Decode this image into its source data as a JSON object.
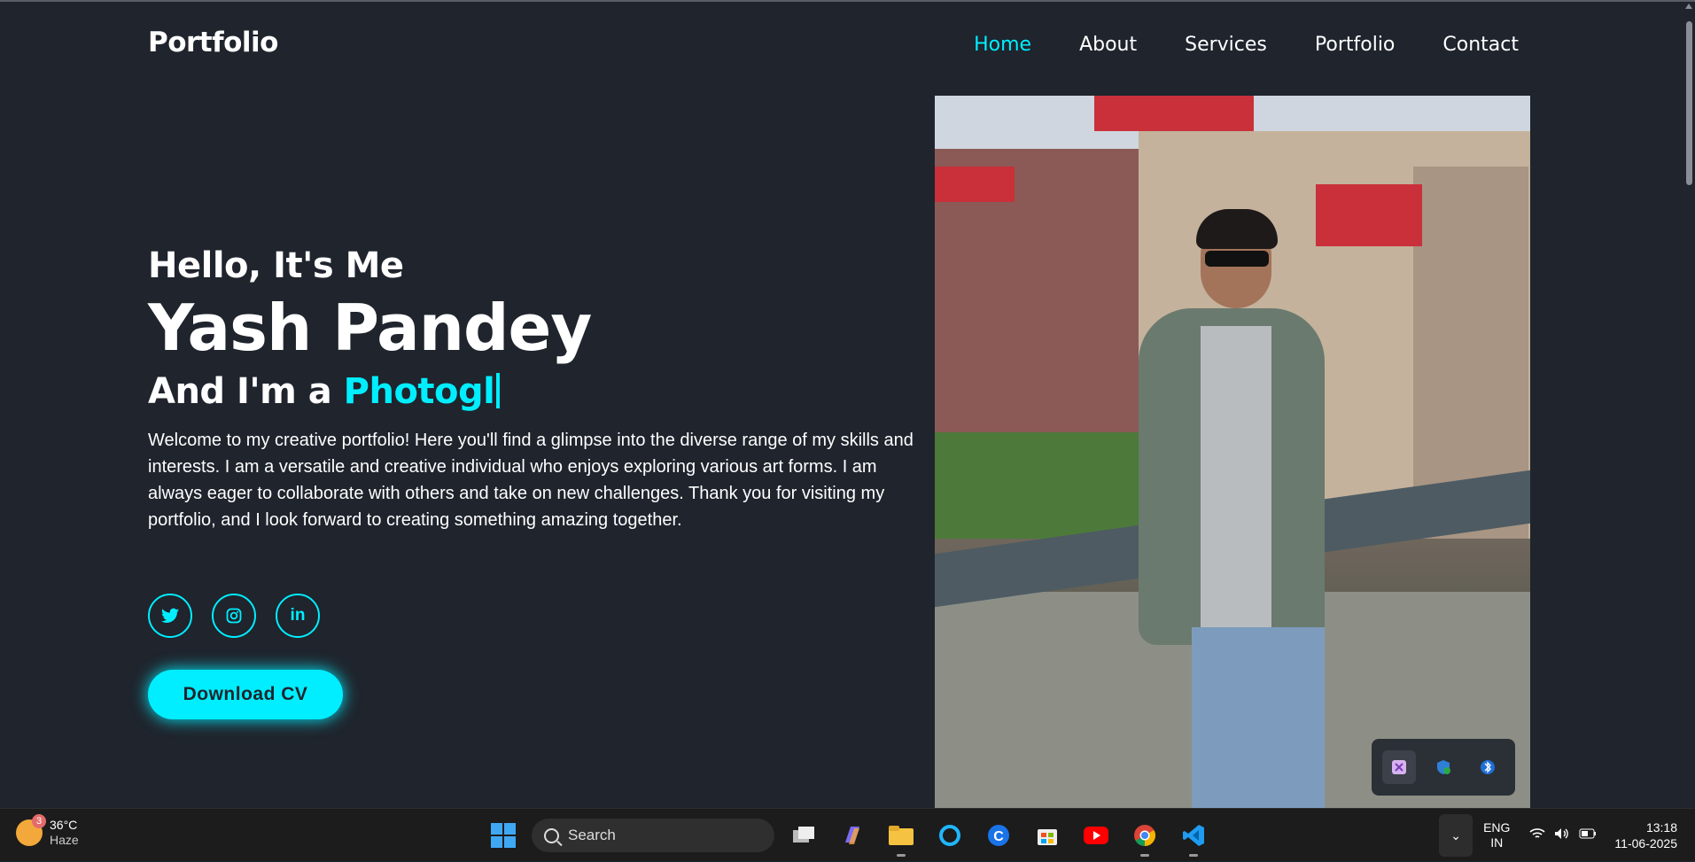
{
  "header": {
    "logo": "Portfolio",
    "nav": [
      {
        "label": "Home",
        "active": true
      },
      {
        "label": "About",
        "active": false
      },
      {
        "label": "Services",
        "active": false
      },
      {
        "label": "Portfolio",
        "active": false
      },
      {
        "label": "Contact",
        "active": false
      }
    ]
  },
  "hero": {
    "greeting": "Hello, It's Me",
    "name": "Yash Pandey",
    "role_prefix": "And I'm a ",
    "role_typed": "Photogl",
    "description": "Welcome to my creative portfolio! Here you'll find a glimpse into the diverse range of my skills and interests. I am a versatile and creative individual who enjoys exploring various art forms. I am always eager to collaborate with others and take on new challenges. Thank you for visiting my portfolio, and I look forward to creating something amazing together.",
    "social": [
      {
        "icon": "twitter-icon",
        "glyph": "🐦"
      },
      {
        "icon": "instagram-icon",
        "glyph": "◎"
      },
      {
        "icon": "linkedin-icon",
        "glyph": "in"
      }
    ],
    "cta": "Download CV"
  },
  "colors": {
    "accent": "#00eeff",
    "background": "#1f242d"
  },
  "taskbar": {
    "weather": {
      "temp": "36°C",
      "condition": "Haze",
      "badge": "3"
    },
    "search_placeholder": "Search",
    "apps": [
      "task-view-icon",
      "copilot-icon",
      "file-explorer-icon",
      "cortana-icon",
      "c-app-icon",
      "store-icon",
      "youtube-icon",
      "chrome-icon",
      "vscode-icon"
    ],
    "lang": "ENG",
    "region": "IN",
    "time": "13:18",
    "date": "11-06-2025"
  }
}
